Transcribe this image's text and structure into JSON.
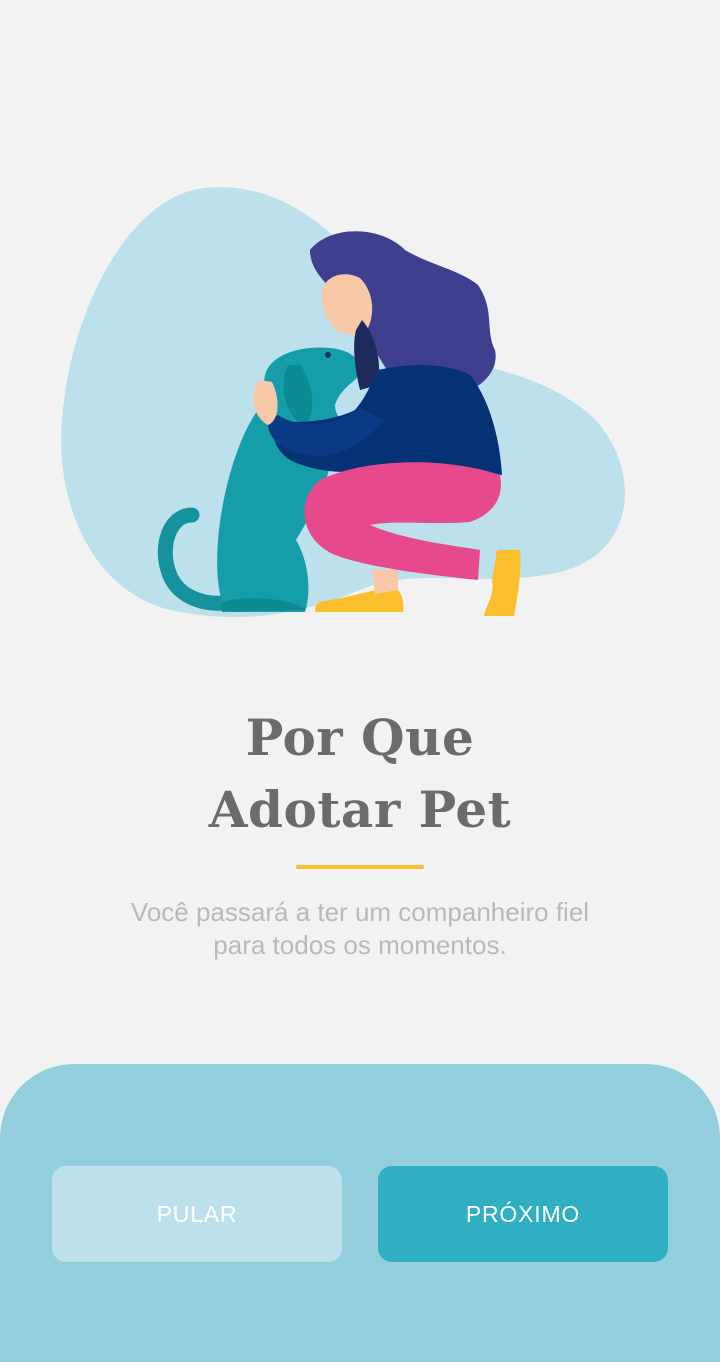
{
  "onboarding": {
    "title_line1": "Por Que",
    "title_line2": "Adotar Pet",
    "subtitle_line1": "Você passará a ter um companheiro fiel",
    "subtitle_line2": "para todos os momentos.",
    "illustration": "woman-hugging-dog-illustration"
  },
  "actions": {
    "skip_label": "PULAR",
    "next_label": "PRÓXIMO"
  },
  "colors": {
    "background": "#f2f2f2",
    "accent_divider": "#fbbf2d",
    "panel": "#93cedd",
    "skip_button": "#bde1ec",
    "next_button": "#31afc2",
    "title_text": "#6b6b6b",
    "subtitle_text": "#b9b9b9"
  }
}
